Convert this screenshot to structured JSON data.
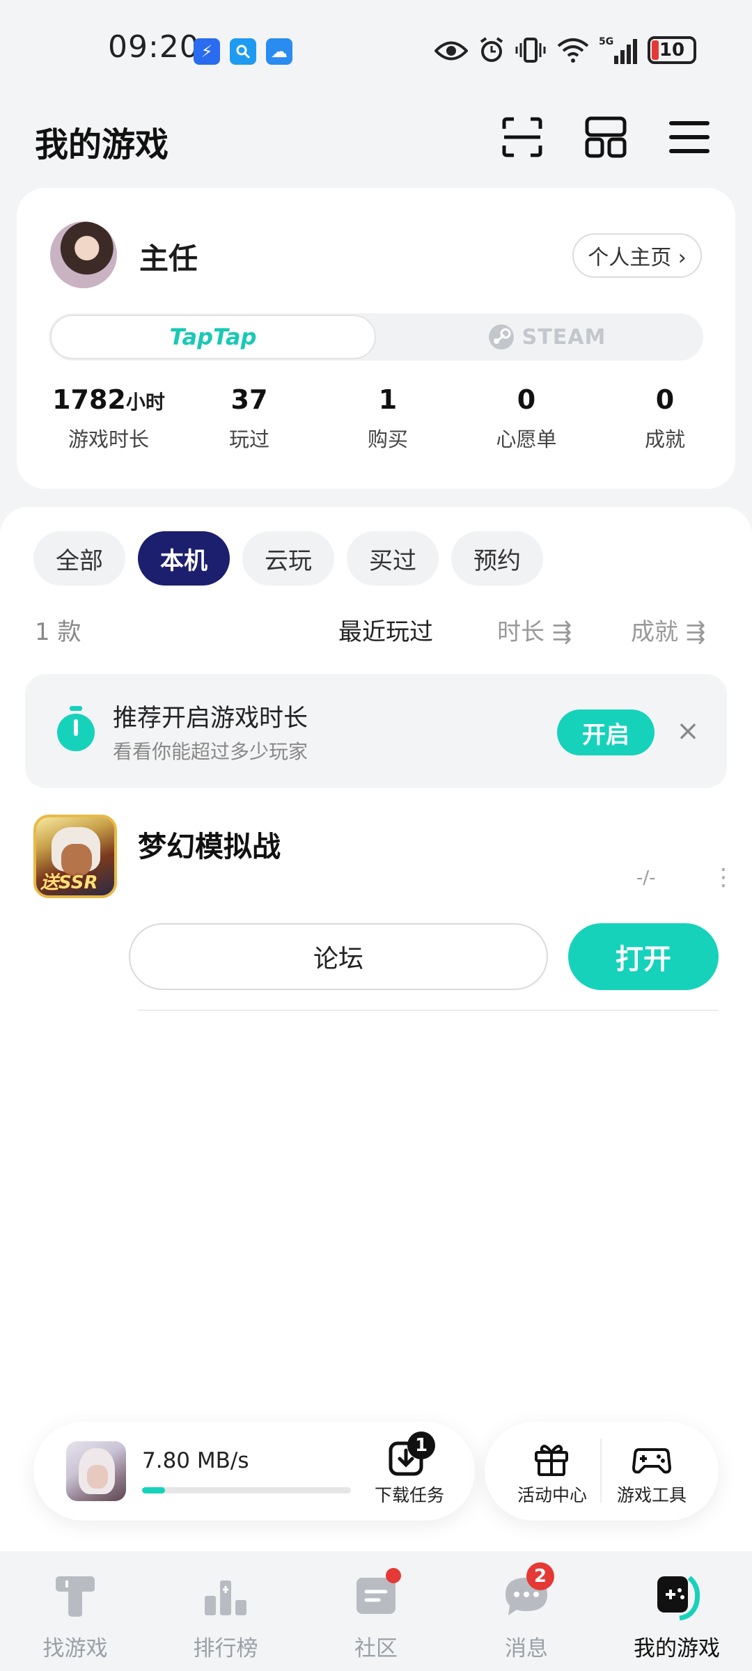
{
  "status_bar": {
    "time": "09:20",
    "battery": "10"
  },
  "header": {
    "title": "我的游戏"
  },
  "profile": {
    "name": "主任",
    "homepage_button": "个人主页 ›",
    "segments": [
      "TapTap",
      "STEAM"
    ],
    "stats": [
      {
        "value": "1782",
        "unit": "小时",
        "label": "游戏时长"
      },
      {
        "value": "37",
        "unit": "",
        "label": "玩过"
      },
      {
        "value": "1",
        "unit": "",
        "label": "购买"
      },
      {
        "value": "0",
        "unit": "",
        "label": "心愿单"
      },
      {
        "value": "0",
        "unit": "",
        "label": "成就"
      }
    ]
  },
  "filters": [
    "全部",
    "本机",
    "云玩",
    "买过",
    "预约"
  ],
  "active_filter": "本机",
  "list_header": {
    "count": "1 款",
    "sort_recent": "最近玩过",
    "sort_time": "时长 ⇶",
    "sort_achievement": "成就 ⇶"
  },
  "banner": {
    "title": "推荐开启游戏时长",
    "subtitle": "看看你能超过多少玩家",
    "button": "开启",
    "close": "×"
  },
  "game": {
    "name": "梦幻模拟战",
    "icon_tag": "送SSR",
    "playtime": "-/-",
    "forum_button": "论坛",
    "open_button": "打开"
  },
  "download": {
    "speed": "7.80 MB/s",
    "progress": 0.11,
    "task_label": "下载任务",
    "task_badge": "1"
  },
  "tools": {
    "activity_label": "活动中心",
    "game_tools_label": "游戏工具"
  },
  "bottom_nav": {
    "items": [
      {
        "label": "找游戏",
        "icon": "find-game-icon"
      },
      {
        "label": "排行榜",
        "icon": "ranking-icon"
      },
      {
        "label": "社区",
        "icon": "community-icon"
      },
      {
        "label": "消息",
        "icon": "message-icon"
      },
      {
        "label": "我的游戏",
        "icon": "my-games-icon"
      }
    ],
    "message_badge": "2",
    "active": "我的游戏"
  },
  "colors": {
    "accent": "#16d2bb",
    "active_chip": "#1c1f6e",
    "badge": "#e53935"
  }
}
